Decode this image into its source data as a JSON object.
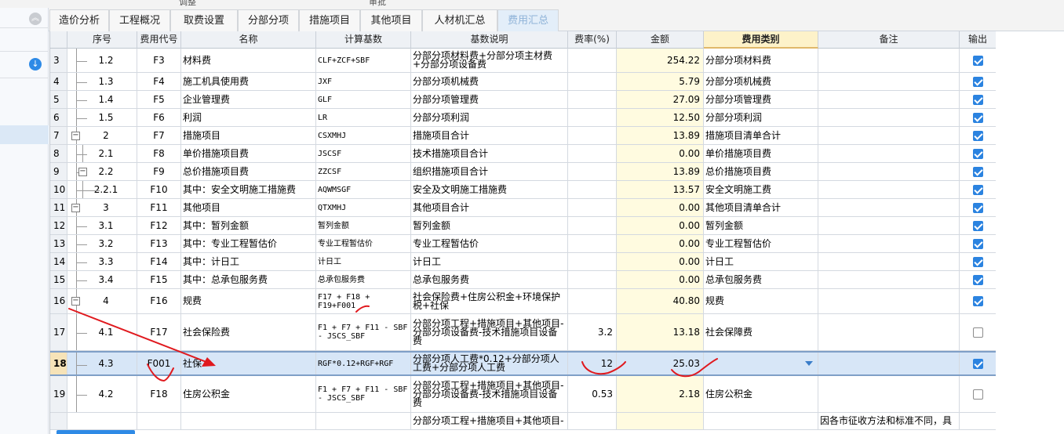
{
  "top_partial": {
    "left": "调整",
    "right": "审批"
  },
  "tabs": [
    {
      "label": "造价分析",
      "active": false
    },
    {
      "label": "工程概况",
      "active": false
    },
    {
      "label": "取费设置",
      "active": false
    },
    {
      "label": "分部分项",
      "active": false
    },
    {
      "label": "措施项目",
      "active": false
    },
    {
      "label": "其他项目",
      "active": false
    },
    {
      "label": "人材机汇总",
      "active": false
    },
    {
      "label": "费用汇总",
      "active": true
    }
  ],
  "columns": {
    "seq": "序号",
    "code": "费用代号",
    "name": "名称",
    "base": "计算基数",
    "desc": "基数说明",
    "rate": "费率(%)",
    "amount": "金额",
    "type": "费用类别",
    "note": "备注",
    "out": "输出"
  },
  "rows": [
    {
      "row": "3",
      "seq": "1.2",
      "code": "F3",
      "name": "材料费",
      "base": "CLF+ZCF+SBF",
      "desc": "分部分项材料费+分部分项主材费+分部分项设备费",
      "rate": "",
      "amount": "254.22",
      "type": "分部分项材料费",
      "note": "",
      "out": true
    },
    {
      "row": "4",
      "seq": "1.3",
      "code": "F4",
      "name": "施工机具使用费",
      "base": "JXF",
      "desc": "分部分项机械费",
      "rate": "",
      "amount": "5.79",
      "type": "分部分项机械费",
      "note": "",
      "out": true
    },
    {
      "row": "5",
      "seq": "1.4",
      "code": "F5",
      "name": "企业管理费",
      "base": "GLF",
      "desc": "分部分项管理费",
      "rate": "",
      "amount": "27.09",
      "type": "分部分项管理费",
      "note": "",
      "out": true
    },
    {
      "row": "6",
      "seq": "1.5",
      "code": "F6",
      "name": "利润",
      "base": "LR",
      "desc": "分部分项利润",
      "rate": "",
      "amount": "12.50",
      "type": "分部分项利润",
      "note": "",
      "out": true
    },
    {
      "row": "7",
      "seq": "2",
      "code": "F7",
      "name": "措施项目",
      "base": "CSXMHJ",
      "desc": "措施项目合计",
      "rate": "",
      "amount": "13.89",
      "type": "措施项目清单合计",
      "note": "",
      "out": true
    },
    {
      "row": "8",
      "seq": "2.1",
      "code": "F8",
      "name": " 单价措施项目费",
      "base": "JSCSF",
      "desc": "技术措施项目合计",
      "rate": "",
      "amount": "0.00",
      "type": "单价措施项目费",
      "note": "",
      "out": true
    },
    {
      "row": "9",
      "seq": "2.2",
      "code": "F9",
      "name": " 总价措施项目费",
      "base": "ZZCSF",
      "desc": "组织措施项目合计",
      "rate": "",
      "amount": "13.89",
      "type": "总价措施项目费",
      "note": "",
      "out": true
    },
    {
      "row": "10",
      "seq": "2.2.1",
      "code": "F10",
      "name": "其中：安全文明施工措施费",
      "base": "AQWMSGF",
      "desc": "安全及文明施工措施费",
      "rate": "",
      "amount": "13.57",
      "type": "安全文明施工费",
      "note": "",
      "out": true
    },
    {
      "row": "11",
      "seq": "3",
      "code": "F11",
      "name": "其他项目",
      "base": "QTXMHJ",
      "desc": "其他项目合计",
      "rate": "",
      "amount": "0.00",
      "type": "其他项目清单合计",
      "note": "",
      "out": true
    },
    {
      "row": "12",
      "seq": "3.1",
      "code": "F12",
      "name": "其中：暂列金额",
      "base": "暂列金额",
      "desc": "暂列金额",
      "rate": "",
      "amount": "0.00",
      "type": "暂列金额",
      "note": "",
      "out": true
    },
    {
      "row": "13",
      "seq": "3.2",
      "code": "F13",
      "name": "其中：专业工程暂估价",
      "base": "专业工程暂估价",
      "desc": "专业工程暂估价",
      "rate": "",
      "amount": "0.00",
      "type": "专业工程暂估价",
      "note": "",
      "out": true
    },
    {
      "row": "14",
      "seq": "3.3",
      "code": "F14",
      "name": "其中：计日工",
      "base": "计日工",
      "desc": "计日工",
      "rate": "",
      "amount": "0.00",
      "type": "计日工",
      "note": "",
      "out": true
    },
    {
      "row": "15",
      "seq": "3.4",
      "code": "F15",
      "name": "其中：总承包服务费",
      "base": "总承包服务费",
      "desc": "总承包服务费",
      "rate": "",
      "amount": "0.00",
      "type": "总承包服务费",
      "note": "",
      "out": true
    },
    {
      "row": "16",
      "seq": "4",
      "code": "F16",
      "name": "规费",
      "base": "F17 + F18 + F19+F001",
      "desc": "社会保险费+住房公积金+环境保护税+社保",
      "rate": "",
      "amount": "40.80",
      "type": "规费",
      "note": "",
      "out": true
    },
    {
      "row": "17",
      "seq": "4.1",
      "code": "F17",
      "name": "社会保险费",
      "base": "F1 + F7 + F11 - SBF - JSCS_SBF",
      "desc": "分部分项工程+措施项目+其他项目-分部分项设备费-技术措施项目设备费",
      "rate": "3.2",
      "amount": "13.18",
      "type": "社会保障费",
      "note": "",
      "out": false
    },
    {
      "row": "18",
      "seq": "4.3",
      "code": "F001",
      "name": "社保",
      "base": "RGF*0.12+RGF+RGF",
      "desc": "分部分项人工费*0.12+分部分项人工费+分部分项人工费",
      "rate": "12",
      "amount": "25.03",
      "type": "",
      "note": "",
      "out": true
    },
    {
      "row": "19",
      "seq": "4.2",
      "code": "F18",
      "name": "住房公积金",
      "base": "F1 + F7 + F11 - SBF - JSCS_SBF",
      "desc": "分部分项工程+措施项目+其他项目-分部分项设备费-技术措施项目设备费",
      "rate": "0.53",
      "amount": "2.18",
      "type": "住房公积金",
      "note": "",
      "out": false
    },
    {
      "row": "",
      "seq": "",
      "code": "",
      "name": "",
      "base": "",
      "desc": "分部分项工程+措施项目+其他项目-",
      "rate": "",
      "amount": "",
      "type": "",
      "note": "因各市征收方法和标准不同，具",
      "out": null
    }
  ],
  "colors": {
    "accent": "#2b83e0",
    "selection": "#d7e6f7",
    "amount_bg": "#fffbe0",
    "annotation": "#e0191e"
  }
}
